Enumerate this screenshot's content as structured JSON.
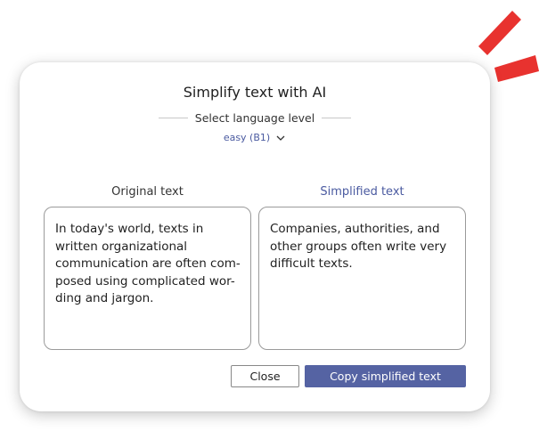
{
  "colors": {
    "accent": "#5563a3",
    "accent_text": "#4a5aa0",
    "burst": "#e8322f"
  },
  "dialog": {
    "title": "Simplify text with AI",
    "language_level_label": "Select language level",
    "language_level_value": "easy (B1)",
    "original": {
      "heading": "Original text",
      "lines": [
        "In today's world, texts in",
        "written organizational",
        "communication are often com-",
        "posed using complicated wor-",
        "ding and jargon."
      ]
    },
    "simplified": {
      "heading": "Simplified text",
      "lines": [
        "Companies, authorities, and",
        "other groups often write very",
        "difficult texts."
      ]
    },
    "buttons": {
      "close_label": "Close",
      "copy_label": "Copy simplified text"
    }
  },
  "icons": {
    "level_dropdown": "chevron-down-icon",
    "decoration": "accent-burst-icon"
  }
}
